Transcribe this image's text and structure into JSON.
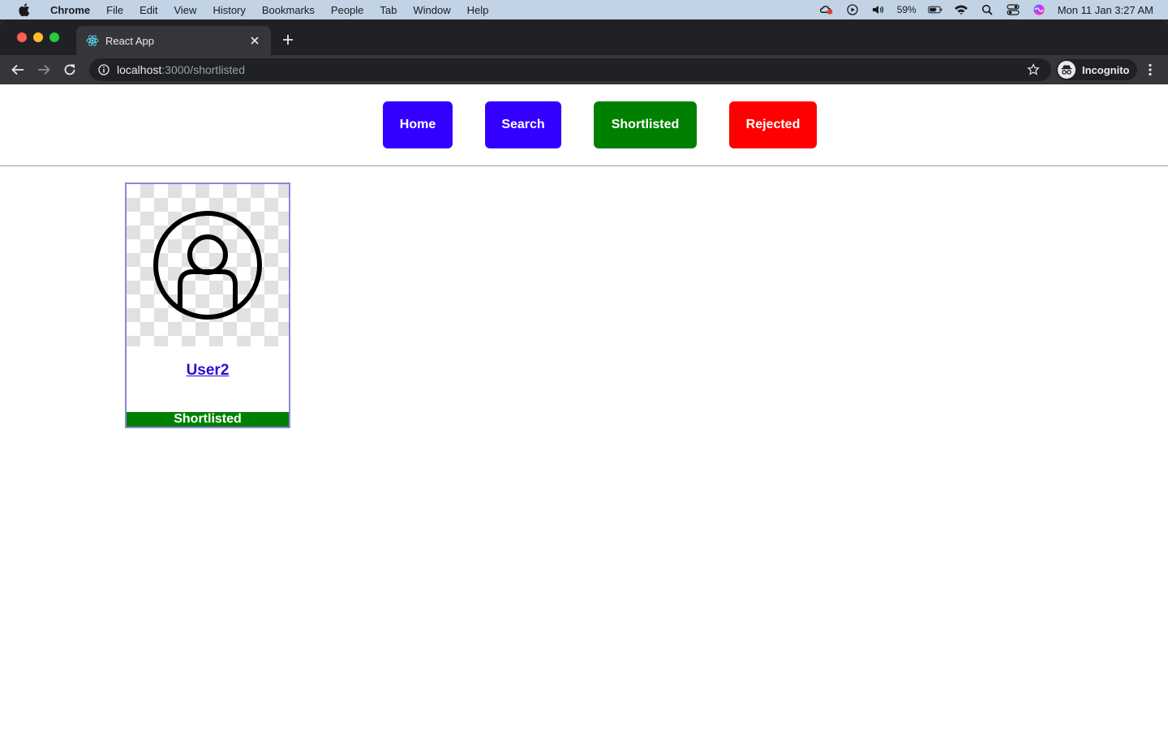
{
  "menubar": {
    "app_name": "Chrome",
    "items": [
      "File",
      "Edit",
      "View",
      "History",
      "Bookmarks",
      "People",
      "Tab",
      "Window",
      "Help"
    ],
    "battery_percent": "59%",
    "datetime": "Mon 11 Jan  3:27 AM"
  },
  "browser": {
    "tab_title": "React App",
    "url_host": "localhost",
    "url_path": ":3000/shortlisted",
    "profile_label": "Incognito"
  },
  "nav": {
    "home": {
      "label": "Home",
      "color": "#3300ff"
    },
    "search": {
      "label": "Search",
      "color": "#3300ff"
    },
    "shortlisted": {
      "label": "Shortlisted",
      "color": "#008000"
    },
    "rejected": {
      "label": "Rejected",
      "color": "#ff0000"
    }
  },
  "users": [
    {
      "name": "User2",
      "status": "Shortlisted",
      "status_color": "#008000",
      "avatar_icon": "user-circle-icon"
    }
  ]
}
